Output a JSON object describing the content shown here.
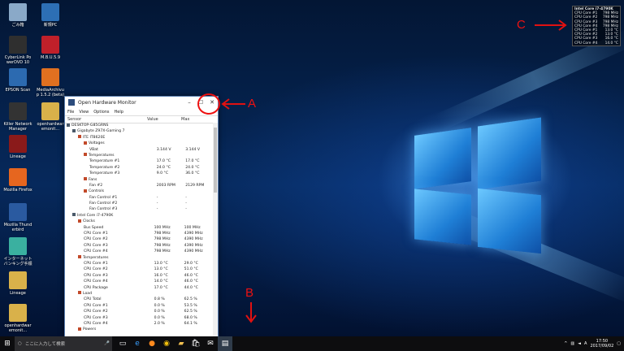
{
  "desktop_icons": [
    {
      "label": "ごみ箱",
      "color": "#8aa9c8"
    },
    {
      "label": "新規PC",
      "color": "#2d6fb5"
    },
    {
      "label": "CyberLink PowerDVD 10",
      "color": "#2f2f2f"
    },
    {
      "label": "M.B.U.5.9",
      "color": "#c0202a"
    },
    {
      "label": "EPSON Scan",
      "color": "#2c6ab0"
    },
    {
      "label": "MediaArchivup 1.5.2 (beta)",
      "color": "#e07020"
    },
    {
      "label": "Killer Network Manager",
      "color": "#333333"
    },
    {
      "label": "openhardwaremonit...",
      "color": "#d9b14a"
    },
    {
      "label": "Lineage",
      "color": "#8a1a1a"
    },
    {
      "label": "Mozilla Firefox",
      "color": "#e6661f"
    },
    {
      "label": "Mozilla Thunderbird",
      "color": "#2a5aa0"
    },
    {
      "label": "インターネットバンキング手順",
      "color": "#3ab0a0"
    },
    {
      "label": "Lineage",
      "color": "#d9b14a"
    },
    {
      "label": "openhardwaremonit...",
      "color": "#d9b14a"
    }
  ],
  "ohm": {
    "title": "Open Hardware Monitor",
    "menu": [
      "File",
      "View",
      "Options",
      "Help"
    ],
    "columns": [
      "Sensor",
      "Value",
      "Max"
    ],
    "rows": [
      {
        "indent": 0,
        "name": "DESKTOP-G85GRNS",
        "value": "",
        "max": ""
      },
      {
        "indent": 1,
        "name": "Gigabyte Z97X-Gaming 7",
        "value": "",
        "max": ""
      },
      {
        "indent": 2,
        "name": "ITE IT8620E",
        "value": "",
        "max": ""
      },
      {
        "indent": 3,
        "name": "Voltages",
        "value": "",
        "max": ""
      },
      {
        "indent": 4,
        "name": "VBat",
        "value": "3.144 V",
        "max": "3.144 V"
      },
      {
        "indent": 3,
        "name": "Temperatures",
        "value": "",
        "max": ""
      },
      {
        "indent": 4,
        "name": "Temperature #1",
        "value": "17.0 °C",
        "max": "17.0 °C"
      },
      {
        "indent": 4,
        "name": "Temperature #2",
        "value": "24.0 °C",
        "max": "24.0 °C"
      },
      {
        "indent": 4,
        "name": "Temperature #3",
        "value": "9.0 °C",
        "max": "36.0 °C"
      },
      {
        "indent": 3,
        "name": "Fans",
        "value": "",
        "max": ""
      },
      {
        "indent": 4,
        "name": "Fan #2",
        "value": "2003 RPM",
        "max": "2129 RPM"
      },
      {
        "indent": 3,
        "name": "Controls",
        "value": "",
        "max": ""
      },
      {
        "indent": 4,
        "name": "Fan Control #1",
        "value": "-",
        "max": "-"
      },
      {
        "indent": 4,
        "name": "Fan Control #2",
        "value": "-",
        "max": "-"
      },
      {
        "indent": 4,
        "name": "Fan Control #3",
        "value": "-",
        "max": "-"
      },
      {
        "indent": 1,
        "name": "Intel Core i7-4790K",
        "value": "",
        "max": ""
      },
      {
        "indent": 2,
        "name": "Clocks",
        "value": "",
        "max": ""
      },
      {
        "indent": 3,
        "name": "Bus Speed",
        "value": "100 MHz",
        "max": "100 MHz"
      },
      {
        "indent": 3,
        "name": "CPU Core #1",
        "value": "798 MHz",
        "max": "4390 MHz"
      },
      {
        "indent": 3,
        "name": "CPU Core #2",
        "value": "798 MHz",
        "max": "4390 MHz"
      },
      {
        "indent": 3,
        "name": "CPU Core #3",
        "value": "798 MHz",
        "max": "4390 MHz"
      },
      {
        "indent": 3,
        "name": "CPU Core #4",
        "value": "798 MHz",
        "max": "4390 MHz"
      },
      {
        "indent": 2,
        "name": "Temperatures",
        "value": "",
        "max": ""
      },
      {
        "indent": 3,
        "name": "CPU Core #1",
        "value": "13.0 °C",
        "max": "29.0 °C"
      },
      {
        "indent": 3,
        "name": "CPU Core #2",
        "value": "13.0 °C",
        "max": "51.0 °C"
      },
      {
        "indent": 3,
        "name": "CPU Core #3",
        "value": "16.0 °C",
        "max": "46.0 °C"
      },
      {
        "indent": 3,
        "name": "CPU Core #4",
        "value": "14.0 °C",
        "max": "46.0 °C"
      },
      {
        "indent": 3,
        "name": "CPU Package",
        "value": "17.0 °C",
        "max": "44.0 °C"
      },
      {
        "indent": 2,
        "name": "Load",
        "value": "",
        "max": ""
      },
      {
        "indent": 3,
        "name": "CPU Total",
        "value": "0.8 %",
        "max": "62.5 %"
      },
      {
        "indent": 3,
        "name": "CPU Core #1",
        "value": "0.0 %",
        "max": "53.5 %"
      },
      {
        "indent": 3,
        "name": "CPU Core #2",
        "value": "0.0 %",
        "max": "62.5 %"
      },
      {
        "indent": 3,
        "name": "CPU Core #3",
        "value": "0.0 %",
        "max": "68.0 %"
      },
      {
        "indent": 3,
        "name": "CPU Core #4",
        "value": "2.0 %",
        "max": "64.1 %"
      },
      {
        "indent": 2,
        "name": "Powers",
        "value": "",
        "max": ""
      }
    ]
  },
  "gadget": {
    "title": "Intel Core i7-4790K",
    "rows": [
      {
        "label": "CPU Core #1",
        "value": "798 MHz"
      },
      {
        "label": "CPU Core #2",
        "value": "798 MHz"
      },
      {
        "label": "CPU Core #3",
        "value": "798 MHz"
      },
      {
        "label": "CPU Core #4",
        "value": "798 MHz"
      },
      {
        "label": "CPU Core #1",
        "value": "13.0 °C"
      },
      {
        "label": "CPU Core #2",
        "value": "13.0 °C"
      },
      {
        "label": "CPU Core #3",
        "value": "16.0 °C"
      },
      {
        "label": "CPU Core #4",
        "value": "14.0 °C"
      }
    ]
  },
  "annotations": {
    "a": "A",
    "b": "B",
    "c": "C",
    "color": "#e11111"
  },
  "taskbar": {
    "search_placeholder": "ここに入力して検索",
    "tray_a": "A",
    "time": "17:50",
    "date": "2017/09/02"
  }
}
